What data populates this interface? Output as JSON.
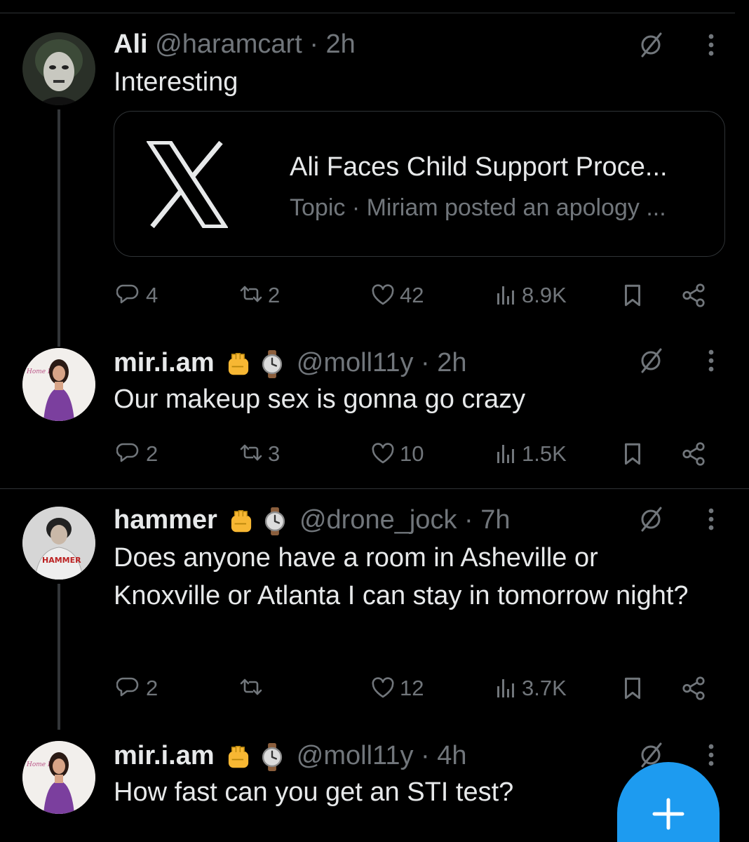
{
  "tweets": [
    {
      "name": "Ali",
      "handle": "@haramcart",
      "time": "· 2h",
      "text": "Interesting",
      "card": {
        "title": "Ali Faces Child Support Proce...",
        "meta": "Topic · Miriam posted an apology ..."
      },
      "replies": "4",
      "reposts": "2",
      "likes": "42",
      "views": "8.9K"
    },
    {
      "name": "mir.i.am",
      "handle": "@moll11y",
      "time": "· 2h",
      "text": "Our makeup sex is gonna go crazy",
      "replies": "2",
      "reposts": "3",
      "likes": "10",
      "views": "1.5K"
    },
    {
      "name": "hammer",
      "handle": "@drone_jock",
      "time": "· 7h",
      "text": "Does anyone have a room in Asheville or Knoxville or Atlanta I can stay in tomorrow night?",
      "replies": "2",
      "reposts": "",
      "likes": "12",
      "views": "3.7K"
    },
    {
      "name": "mir.i.am",
      "handle": "@moll11y",
      "time": "· 4h",
      "text": "How fast can you get an STI test?"
    }
  ],
  "icons": {
    "reply": "reply-icon",
    "repost": "repost-icon",
    "like": "heart-icon",
    "views": "views-icon",
    "bookmark": "bookmark-icon",
    "share": "share-icon",
    "grok": "grok-icon",
    "more": "more-icon",
    "compose": "plus-icon",
    "badge_fist": "raised-fist-emoji",
    "badge_watch": "watch-emoji"
  },
  "colors": {
    "background": "#000000",
    "text": "#e7e9ea",
    "muted": "#71767b",
    "accent": "#1d9bf0",
    "border": "#2f3336"
  }
}
